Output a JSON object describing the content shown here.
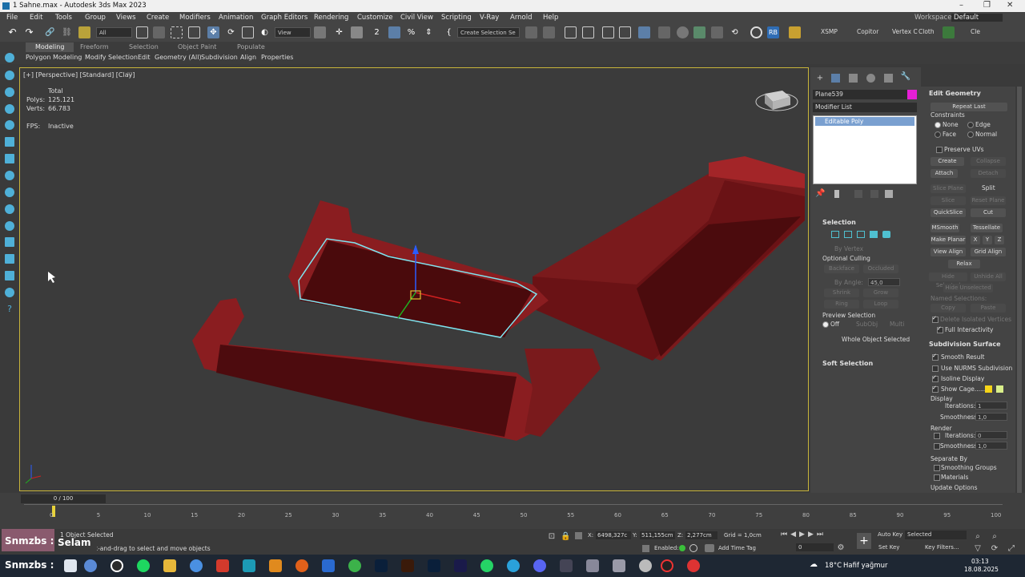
{
  "window": {
    "title": "1 Sahne.max - Autodesk 3ds Max 2023",
    "workspaces_label": "Workspaces:",
    "workspace_value": "Default"
  },
  "menu": [
    "File",
    "Edit",
    "Tools",
    "Group",
    "Views",
    "Create",
    "Modifiers",
    "Animation",
    "Graph Editors",
    "Rendering",
    "Customize",
    "Civil View",
    "Scripting",
    "V-Ray",
    "Arnold",
    "Help"
  ],
  "toolbar": {
    "filter": "All",
    "view": "View",
    "selection_set": "Create Selection Se",
    "xsmp": "XSMP",
    "copitor": "Copitor",
    "vertex": "Vertex C",
    "cloth": "Cloth",
    "cle": "Cle",
    "rb": "RB"
  },
  "ribbon": {
    "tabs": [
      "Modeling",
      "Freeform",
      "Selection",
      "Object Paint",
      "Populate"
    ],
    "sub": [
      "Polygon Modeling",
      "Modify Selection",
      "Edit",
      "Geometry (All)",
      "Subdivision",
      "Align",
      "Properties"
    ]
  },
  "viewport": {
    "label": "[+] [Perspective] [Standard] [Clay]",
    "stats_total": "Total",
    "polys_label": "Polys:",
    "polys_value": "125.121",
    "verts_label": "Verts:",
    "verts_value": "66.783",
    "fps_label": "FPS:",
    "fps_value": "Inactive"
  },
  "command_panel": {
    "object_name": "Plane539",
    "object_color": "#e61fd6",
    "modifier_list": "Modifier List",
    "stack_item": "Editable Poly",
    "selection": {
      "title": "Selection",
      "by_vertex": "By Vertex",
      "optional_culling": "Optional Culling",
      "backface": "Backface",
      "occluded": "Occluded",
      "by_angle": "By Angle:",
      "angle_value": "45,0",
      "shrink": "Shrink",
      "grow": "Grow",
      "ring": "Ring",
      "loop": "Loop",
      "preview_selection": "Preview Selection",
      "off": "Off",
      "subobj": "SubObj",
      "multi": "Multi",
      "whole_object": "Whole Object Selected"
    },
    "soft_selection": "Soft Selection"
  },
  "edit_geometry": {
    "title": "Edit Geometry",
    "repeat_last": "Repeat Last",
    "constraints": "Constraints",
    "none": "None",
    "edge": "Edge",
    "face": "Face",
    "normal": "Normal",
    "preserve_uvs": "Preserve UVs",
    "create": "Create",
    "collapse": "Collapse",
    "attach": "Attach",
    "detach": "Detach",
    "slice_plane": "Slice Plane",
    "split": "Split",
    "slice": "Slice",
    "reset_plane": "Reset Plane",
    "quickslice": "QuickSlice",
    "cut": "Cut",
    "msmooth": "MSmooth",
    "tessellate": "Tessellate",
    "make_planar": "Make Planar",
    "x": "X",
    "y": "Y",
    "z": "Z",
    "view_align": "View Align",
    "grid_align": "Grid Align",
    "relax": "Relax",
    "hide_selected": "Hide Selected",
    "unhide_all": "Unhide All",
    "hide_unselected": "Hide Unselected",
    "named_selections": "Named Selections:",
    "copy": "Copy",
    "paste": "Paste",
    "delete_isolated": "Delete Isolated Vertices",
    "full_interactivity": "Full Interactivity"
  },
  "subdivision": {
    "title": "Subdivision Surface",
    "smooth_result": "Smooth Result",
    "use_nurms": "Use NURMS Subdivision",
    "isoline": "Isoline Display",
    "show_cage": "Show Cage......",
    "display": "Display",
    "iterations": "Iterations:",
    "iter_display": "1",
    "smoothness": "Smoothness:",
    "smooth_display": "1,0",
    "render": "Render",
    "iter_render": "0",
    "smooth_render": "1,0",
    "separate_by": "Separate By",
    "smoothing_groups": "Smoothing Groups",
    "materials": "Materials",
    "update_options": "Update Options",
    "cage_color1": "#f5d418",
    "cage_color2": "#d9ef8a"
  },
  "timeline": {
    "frame": "0 / 100",
    "ticks": [
      "0",
      "5",
      "10",
      "15",
      "20",
      "25",
      "30",
      "35",
      "40",
      "45",
      "50",
      "55",
      "60",
      "65",
      "70",
      "75",
      "80",
      "85",
      "90",
      "95",
      "100"
    ]
  },
  "status": {
    "selected": "1 Object Selected",
    "prompt": "Click or click-and-drag to select and move objects",
    "x_label": "X:",
    "x": "6498,327c",
    "y_label": "Y:",
    "y": "511,155cm",
    "z_label": "Z:",
    "z": "2,277cm",
    "grid": "Grid = 1,0cm",
    "enabled": "Enabled:",
    "add_time_tag": "Add Time Tag",
    "auto_key": "Auto Key",
    "selected_drop": "Selected",
    "set_key": "Set Key",
    "key_filters": "Key Filters...",
    "frame_spin": "0",
    "overlay_tag": "Snmzbs :",
    "overlay_msg": "Selam"
  },
  "taskbar": {
    "label": "Snmzbs :",
    "weather": "18°C",
    "weather_desc": "Hafif yağmur",
    "time": "03:13",
    "date": "18.08.2025"
  }
}
